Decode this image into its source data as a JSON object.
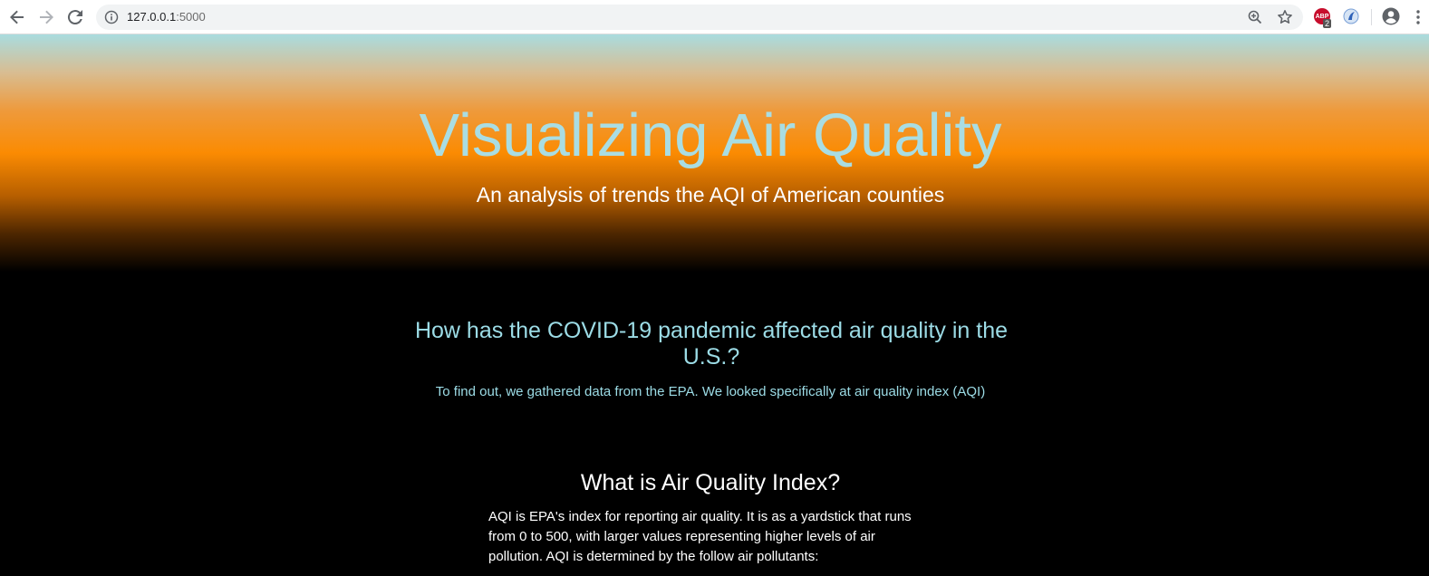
{
  "browser": {
    "url_host": "127.0.0.1",
    "url_port": ":5000",
    "extension_badge_label": "ABP",
    "extension_badge_count": "2",
    "icons": [
      "back-arrow-icon",
      "forward-arrow-icon",
      "reload-icon",
      "info-icon",
      "zoom-icon",
      "star-icon",
      "adblock-icon",
      "extension-icon",
      "account-icon",
      "menu-icon"
    ]
  },
  "hero": {
    "title": "Visualizing Air Quality",
    "subtitle": "An analysis of trends the AQI of American counties",
    "gradient_colors": [
      "#a9dcdf",
      "#fb8b02",
      "#000000"
    ]
  },
  "question": {
    "heading": "How has the COVID-19 pandemic affected air quality in the U.S.?",
    "text": "To find out, we gathered data from the EPA. We looked specifically at air quality index (AQI)"
  },
  "aqi_section": {
    "heading": "What is Air Quality Index?",
    "body": "AQI is EPA's index for reporting air quality. It is as a yardstick that runs from 0 to 500, with larger values representing higher levels of air pollution. AQI is determined by the follow air pollutants:"
  },
  "colors": {
    "accent_light_blue": "#9cdce6",
    "title_blue": "#a9dde3",
    "background": "#000000"
  }
}
